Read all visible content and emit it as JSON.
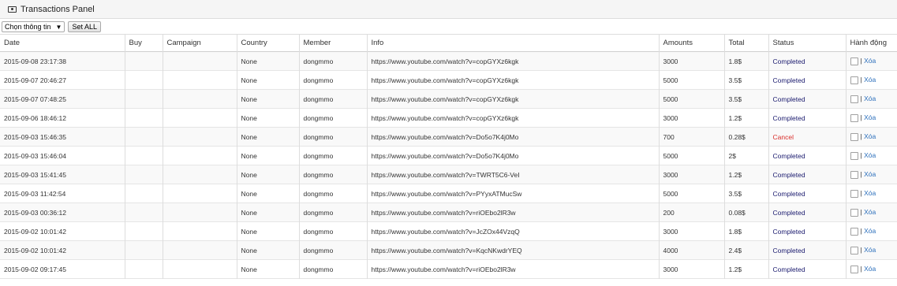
{
  "panel": {
    "title": "Transactions Panel",
    "icon": "money-icon"
  },
  "toolbar": {
    "select_value": "Chọn thông tin",
    "set_all_label": "Set ALL"
  },
  "table": {
    "columns": [
      "Date",
      "Buy",
      "Campaign",
      "Country",
      "Member",
      "Info",
      "Amounts",
      "Total",
      "Status",
      "Hành động"
    ],
    "action_separator": "|",
    "action_label": "Xóa",
    "rows": [
      {
        "date": "2015-09-08 23:17:38",
        "buy": "",
        "campaign": "",
        "country": "None",
        "member": "dongmmo",
        "info": "https://www.youtube.com/watch?v=copGYXz6kgk",
        "amounts": "3000",
        "total": "1.8$",
        "status": "Completed"
      },
      {
        "date": "2015-09-07 20:46:27",
        "buy": "",
        "campaign": "",
        "country": "None",
        "member": "dongmmo",
        "info": "https://www.youtube.com/watch?v=copGYXz6kgk",
        "amounts": "5000",
        "total": "3.5$",
        "status": "Completed"
      },
      {
        "date": "2015-09-07 07:48:25",
        "buy": "",
        "campaign": "",
        "country": "None",
        "member": "dongmmo",
        "info": "https://www.youtube.com/watch?v=copGYXz6kgk",
        "amounts": "5000",
        "total": "3.5$",
        "status": "Completed"
      },
      {
        "date": "2015-09-06 18:46:12",
        "buy": "",
        "campaign": "",
        "country": "None",
        "member": "dongmmo",
        "info": "https://www.youtube.com/watch?v=copGYXz6kgk",
        "amounts": "3000",
        "total": "1.2$",
        "status": "Completed"
      },
      {
        "date": "2015-09-03 15:46:35",
        "buy": "",
        "campaign": "",
        "country": "None",
        "member": "dongmmo",
        "info": "https://www.youtube.com/watch?v=Do5o7K4j0Mo",
        "amounts": "700",
        "total": "0.28$",
        "status": "Cancel"
      },
      {
        "date": "2015-09-03 15:46:04",
        "buy": "",
        "campaign": "",
        "country": "None",
        "member": "dongmmo",
        "info": "https://www.youtube.com/watch?v=Do5o7K4j0Mo",
        "amounts": "5000",
        "total": "2$",
        "status": "Completed"
      },
      {
        "date": "2015-09-03 15:41:45",
        "buy": "",
        "campaign": "",
        "country": "None",
        "member": "dongmmo",
        "info": "https://www.youtube.com/watch?v=TWRT5C6-VeI",
        "amounts": "3000",
        "total": "1.2$",
        "status": "Completed"
      },
      {
        "date": "2015-09-03 11:42:54",
        "buy": "",
        "campaign": "",
        "country": "None",
        "member": "dongmmo",
        "info": "https://www.youtube.com/watch?v=PYyxATMucSw",
        "amounts": "5000",
        "total": "3.5$",
        "status": "Completed"
      },
      {
        "date": "2015-09-03 00:36:12",
        "buy": "",
        "campaign": "",
        "country": "None",
        "member": "dongmmo",
        "info": "https://www.youtube.com/watch?v=riOEbo2lR3w",
        "amounts": "200",
        "total": "0.08$",
        "status": "Completed"
      },
      {
        "date": "2015-09-02 10:01:42",
        "buy": "",
        "campaign": "",
        "country": "None",
        "member": "dongmmo",
        "info": "https://www.youtube.com/watch?v=JcZOx44VzqQ",
        "amounts": "3000",
        "total": "1.8$",
        "status": "Completed"
      },
      {
        "date": "2015-09-02 10:01:42",
        "buy": "",
        "campaign": "",
        "country": "None",
        "member": "dongmmo",
        "info": "https://www.youtube.com/watch?v=KqcNKwdrYEQ",
        "amounts": "4000",
        "total": "2.4$",
        "status": "Completed"
      },
      {
        "date": "2015-09-02 09:17:45",
        "buy": "",
        "campaign": "",
        "country": "None",
        "member": "dongmmo",
        "info": "https://www.youtube.com/watch?v=riOEbo2lR3w",
        "amounts": "3000",
        "total": "1.2$",
        "status": "Completed"
      }
    ]
  },
  "colors": {
    "completed": "#1a1a6e",
    "cancel": "#d9302c",
    "link": "#2a6ebb"
  }
}
